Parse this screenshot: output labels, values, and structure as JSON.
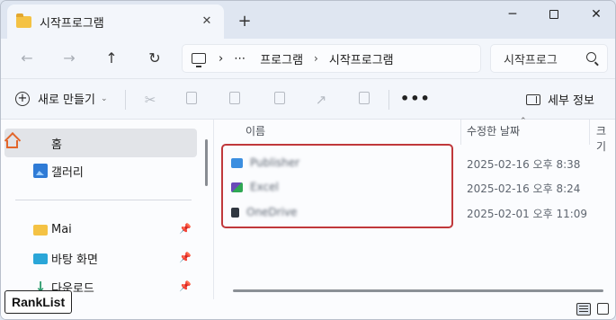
{
  "tab": {
    "title": "시작프로그램",
    "close": "✕",
    "new": "+"
  },
  "window_controls": {
    "minimize": "─",
    "close": "✕"
  },
  "nav": {
    "back": "←",
    "forward": "→",
    "up": "↑",
    "refresh": "↻"
  },
  "address": {
    "more": "⋯",
    "sep": "›",
    "crumbs": [
      "프로그램",
      "시작프로그램"
    ]
  },
  "search": {
    "placeholder": "시작프로그"
  },
  "commandbar": {
    "new_label": "새로 만들기",
    "new_chevron": "⌄",
    "more": "•••",
    "details_label": "세부 정보"
  },
  "sidebar": {
    "items": [
      {
        "label": "홈"
      },
      {
        "label": "갤러리"
      },
      {
        "label": "Mai",
        "pin": "📌"
      },
      {
        "label": "바탕 화면",
        "pin": "📌"
      },
      {
        "label": "다운로드",
        "pin": "📌"
      }
    ]
  },
  "columns": {
    "name": "이름",
    "modified": "수정한 날짜",
    "type": "크기"
  },
  "files": [
    {
      "name": "Publisher",
      "date": "2025-02-16 오후 8:38",
      "icon_color": "#3b8ee0"
    },
    {
      "name": "Excel",
      "date": "2025-02-16 오후 8:24",
      "icon_color": "#6a4ab8"
    },
    {
      "name": "OneDrive",
      "date": "2025-02-01 오후 11:09",
      "icon_color": "#303740"
    }
  ],
  "badge": {
    "text": "RankList"
  }
}
